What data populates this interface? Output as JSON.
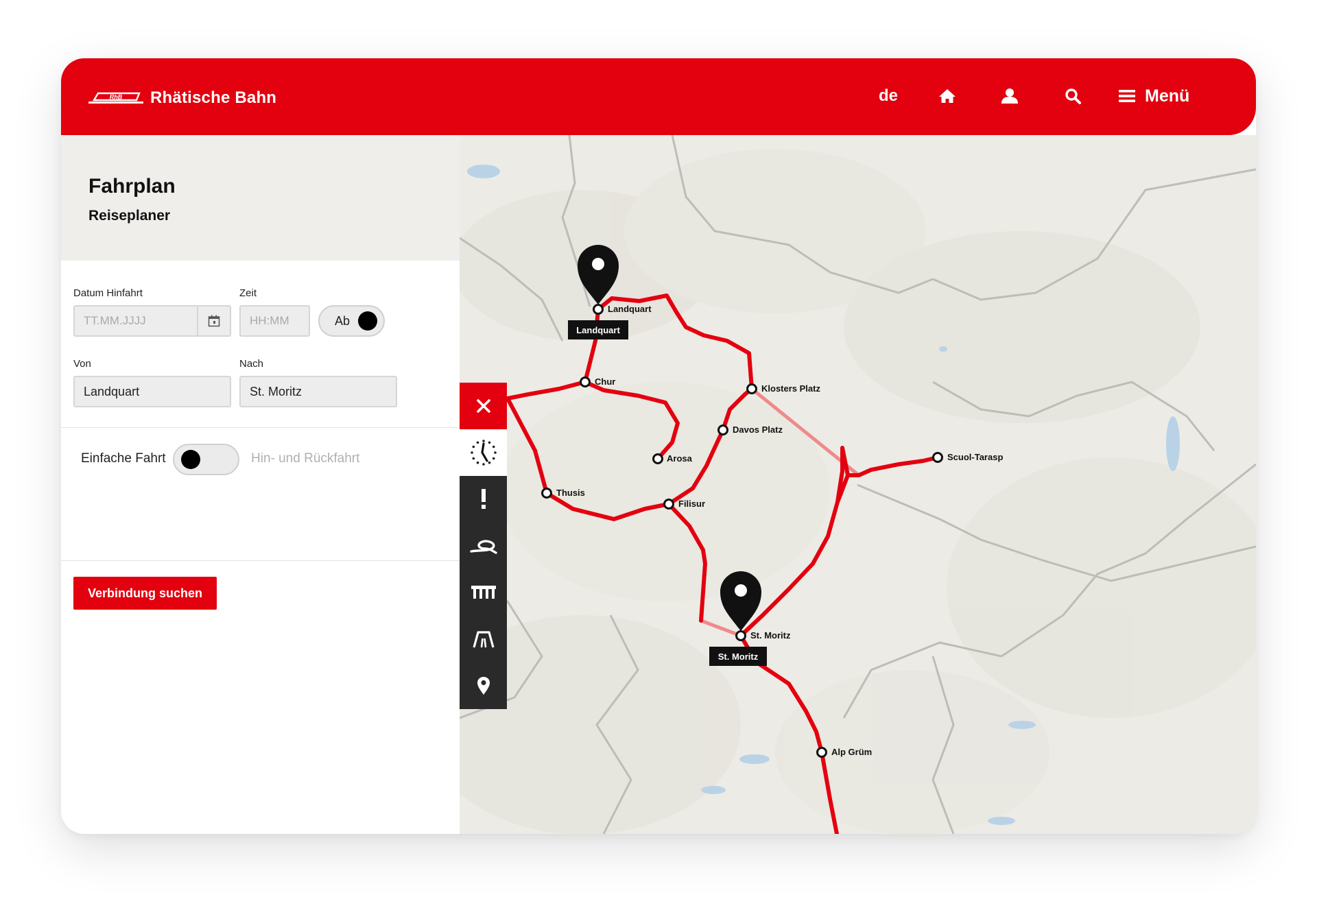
{
  "header": {
    "brand_mark": "RhB",
    "brand_name": "Rhätische Bahn",
    "language": "de",
    "menu_label": "Menü"
  },
  "panel": {
    "title": "Fahrplan",
    "subtitle": "Reiseplaner",
    "date_label": "Datum Hinfahrt",
    "date_placeholder": "TT.MM.JJJJ",
    "time_label": "Zeit",
    "time_placeholder": "HH:MM",
    "depart_toggle_label": "Ab",
    "from_label": "Von",
    "from_value": "Landquart",
    "to_label": "Nach",
    "to_value": "St. Moritz",
    "one_way_label": "Einfache Fahrt",
    "round_trip_label": "Hin- und Rückfahrt",
    "search_button": "Verbindung suchen"
  },
  "toolbar": {
    "items": [
      "close-icon",
      "clock-icon",
      "alert-icon",
      "route-loop-icon",
      "viaduct-icon",
      "tunnel-icon",
      "location-pin-icon"
    ]
  },
  "map": {
    "stations": {
      "landquart": "Landquart",
      "chur": "Chur",
      "arosa": "Arosa",
      "thusis": "Thusis",
      "filisur": "Filisur",
      "davos": "Davos Platz",
      "klosters": "Klosters Platz",
      "scuol": "Scuol-Tarasp",
      "stmoritz": "St. Moritz",
      "alpgruem": "Alp Grüm"
    },
    "pins": {
      "start": "Landquart",
      "end": "St. Moritz"
    }
  },
  "colors": {
    "brand_red": "#e3000f",
    "header_text": "#ffffff",
    "panel_head_bg": "#efeeeb",
    "toolbar_bg": "#2a2a2a",
    "route": "#e3000f",
    "route_light": "#ef8a8a",
    "terrain": "#ecebe5"
  }
}
